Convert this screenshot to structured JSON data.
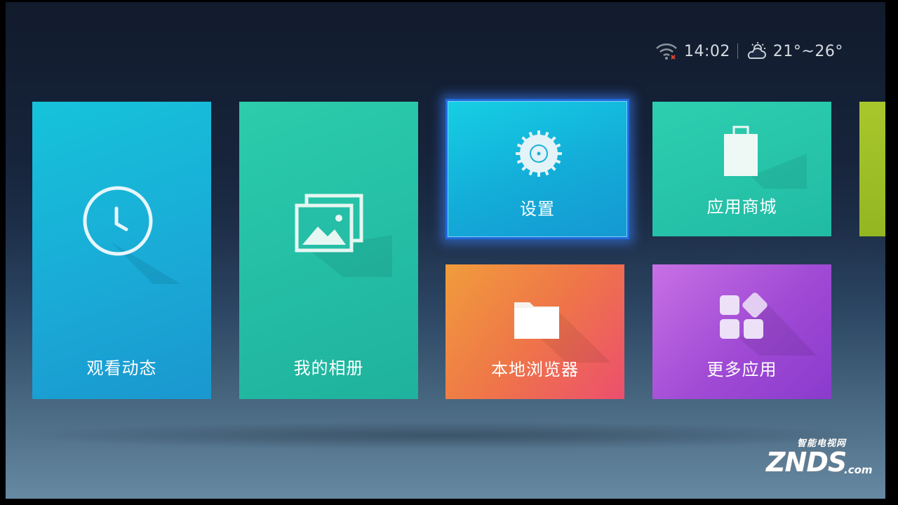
{
  "status": {
    "wifi_icon": "wifi-disconnected-icon",
    "time": "14:02",
    "weather_icon": "partly-cloudy-icon",
    "temperature": "21°~26°"
  },
  "tiles": {
    "watch": {
      "label": "观看动态",
      "icon": "clock-icon",
      "color": "#1aa9d6"
    },
    "album": {
      "label": "我的相册",
      "icon": "photo-album-icon",
      "color": "#23bca4"
    },
    "settings": {
      "label": "设置",
      "icon": "gear-icon",
      "color": "#13acd8",
      "focused": true
    },
    "store": {
      "label": "应用商城",
      "icon": "shopping-bag-icon",
      "color": "#21bba4"
    },
    "browser": {
      "label": "本地浏览器",
      "icon": "folder-icon",
      "color": "#ef7648"
    },
    "more": {
      "label": "更多应用",
      "icon": "app-grid-icon",
      "color": "#a04ad5"
    }
  },
  "watermark": {
    "cn": "智能电视网",
    "brand": "ZNDS",
    "domain": ".com"
  }
}
